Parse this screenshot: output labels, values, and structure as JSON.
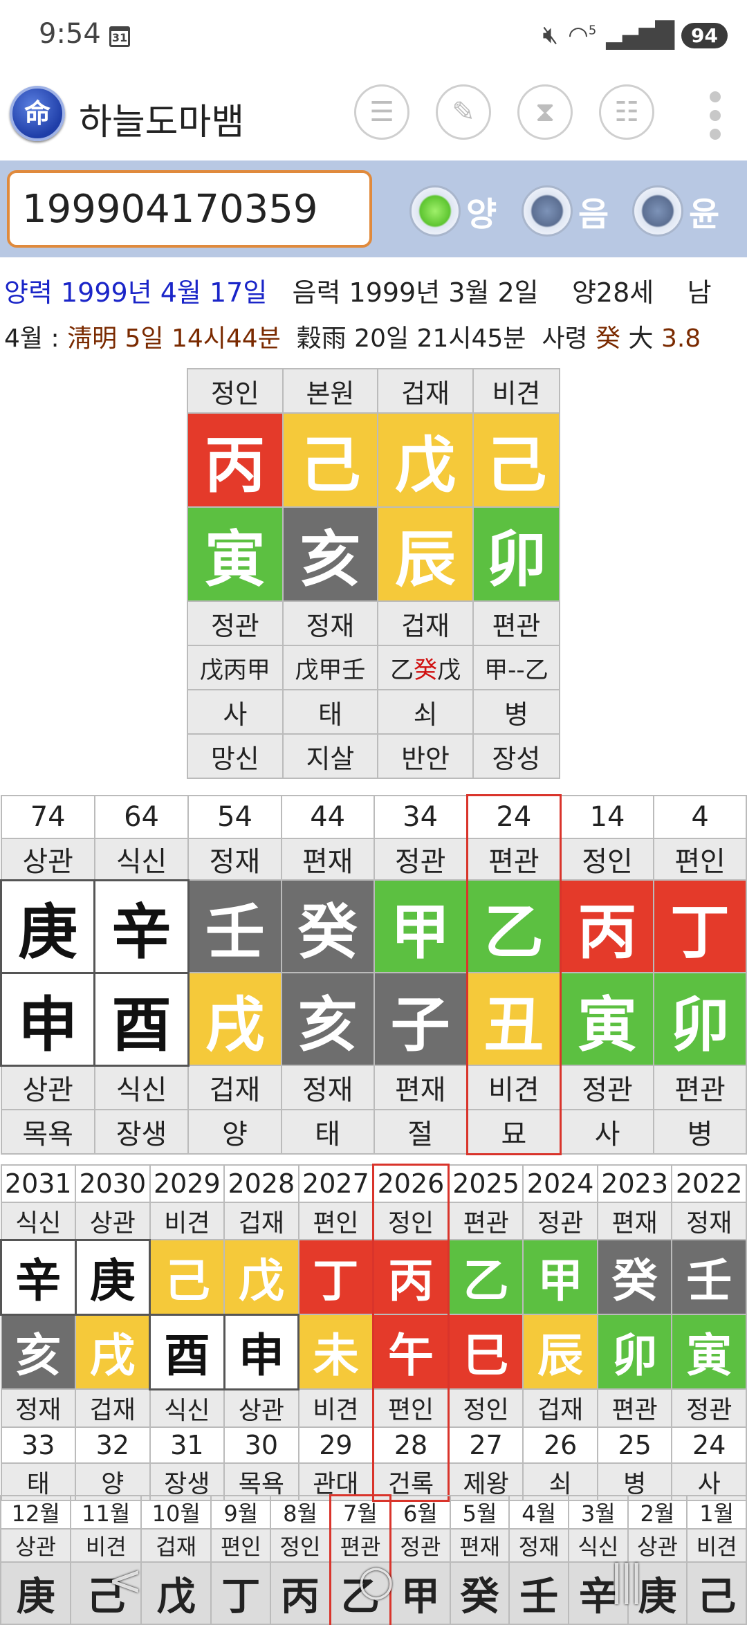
{
  "status": {
    "time": "9:54",
    "calendar_day": "31",
    "wifi_label": "5",
    "battery": "94"
  },
  "app": {
    "logo_char": "命",
    "title": "하늘도마뱀"
  },
  "input": {
    "value": "199904170359"
  },
  "radios": [
    {
      "label": "양",
      "selected": true
    },
    {
      "label": "음",
      "selected": false
    },
    {
      "label": "윤",
      "selected": false
    }
  ],
  "info": {
    "solar": "양력 1999년 4월 17일",
    "lunar": "음력 1999년 3월 2일",
    "age": "양28세",
    "sex": "남",
    "month_prefix": "4월 :",
    "term1": "淸明 5일 14시44분",
    "term2": "穀雨 20일 21시45분",
    "saryeong_label": "사령",
    "saryeong_char": "癸",
    "daeun_char": "大",
    "daeun_num": "3.8"
  },
  "pillars": {
    "top": [
      "정인",
      "본원",
      "겁재",
      "비견"
    ],
    "stems": [
      {
        "c": "丙",
        "k": "R"
      },
      {
        "c": "己",
        "k": "Y"
      },
      {
        "c": "戊",
        "k": "Y"
      },
      {
        "c": "己",
        "k": "Y"
      }
    ],
    "branches": [
      {
        "c": "寅",
        "k": "G"
      },
      {
        "c": "亥",
        "k": "D"
      },
      {
        "c": "辰",
        "k": "Y"
      },
      {
        "c": "卯",
        "k": "G"
      }
    ],
    "gods": [
      "정관",
      "정재",
      "겁재",
      "편관"
    ],
    "hidden": [
      [
        "戊丙甲",
        ""
      ],
      [
        "戊甲壬",
        ""
      ],
      [
        "乙",
        "癸",
        "戊"
      ],
      [
        "甲--乙",
        ""
      ]
    ],
    "stages": [
      "사",
      "태",
      "쇠",
      "병"
    ],
    "spirits": [
      "망신",
      "지살",
      "반안",
      "장성"
    ]
  },
  "daeun": {
    "ages": [
      "74",
      "64",
      "54",
      "44",
      "34",
      "24",
      "14",
      "4"
    ],
    "top": [
      "상관",
      "식신",
      "정재",
      "편재",
      "정관",
      "편관",
      "정인",
      "편인"
    ],
    "stems": [
      {
        "c": "庚",
        "k": "W"
      },
      {
        "c": "辛",
        "k": "W"
      },
      {
        "c": "壬",
        "k": "D"
      },
      {
        "c": "癸",
        "k": "D"
      },
      {
        "c": "甲",
        "k": "G"
      },
      {
        "c": "乙",
        "k": "G"
      },
      {
        "c": "丙",
        "k": "R"
      },
      {
        "c": "丁",
        "k": "R"
      }
    ],
    "branches": [
      {
        "c": "申",
        "k": "W"
      },
      {
        "c": "酉",
        "k": "W"
      },
      {
        "c": "戌",
        "k": "Y"
      },
      {
        "c": "亥",
        "k": "D"
      },
      {
        "c": "子",
        "k": "D"
      },
      {
        "c": "丑",
        "k": "Y"
      },
      {
        "c": "寅",
        "k": "G"
      },
      {
        "c": "卯",
        "k": "G"
      }
    ],
    "bottom": [
      "상관",
      "식신",
      "겁재",
      "정재",
      "편재",
      "비견",
      "정관",
      "편관"
    ],
    "stages": [
      "목욕",
      "장생",
      "양",
      "태",
      "절",
      "묘",
      "사",
      "병"
    ],
    "selected": 5
  },
  "yearly": {
    "years": [
      "2031",
      "2030",
      "2029",
      "2028",
      "2027",
      "2026",
      "2025",
      "2024",
      "2023",
      "2022"
    ],
    "top": [
      "식신",
      "상관",
      "비견",
      "겁재",
      "편인",
      "정인",
      "편관",
      "정관",
      "편재",
      "정재"
    ],
    "stems": [
      {
        "c": "辛",
        "k": "W"
      },
      {
        "c": "庚",
        "k": "W"
      },
      {
        "c": "己",
        "k": "Y"
      },
      {
        "c": "戊",
        "k": "Y"
      },
      {
        "c": "丁",
        "k": "R"
      },
      {
        "c": "丙",
        "k": "R"
      },
      {
        "c": "乙",
        "k": "G"
      },
      {
        "c": "甲",
        "k": "G"
      },
      {
        "c": "癸",
        "k": "D"
      },
      {
        "c": "壬",
        "k": "D"
      }
    ],
    "branches": [
      {
        "c": "亥",
        "k": "D"
      },
      {
        "c": "戌",
        "k": "Y"
      },
      {
        "c": "酉",
        "k": "W"
      },
      {
        "c": "申",
        "k": "W"
      },
      {
        "c": "未",
        "k": "Y"
      },
      {
        "c": "午",
        "k": "R"
      },
      {
        "c": "巳",
        "k": "R"
      },
      {
        "c": "辰",
        "k": "Y"
      },
      {
        "c": "卯",
        "k": "G"
      },
      {
        "c": "寅",
        "k": "G"
      }
    ],
    "bottom": [
      "정재",
      "겁재",
      "식신",
      "상관",
      "비견",
      "편인",
      "정인",
      "겁재",
      "편관",
      "정관"
    ],
    "ages": [
      "33",
      "32",
      "31",
      "30",
      "29",
      "28",
      "27",
      "26",
      "25",
      "24"
    ],
    "stages": [
      "태",
      "양",
      "장생",
      "목욕",
      "관대",
      "건록",
      "제왕",
      "쇠",
      "병",
      "사"
    ],
    "selected": 5
  },
  "monthly": {
    "months": [
      "12월",
      "11월",
      "10월",
      "9월",
      "8월",
      "7월",
      "6월",
      "5월",
      "4월",
      "3월",
      "2월",
      "1월"
    ],
    "top": [
      "상관",
      "비견",
      "겁재",
      "편인",
      "정인",
      "편관",
      "정관",
      "편재",
      "정재",
      "식신",
      "상관",
      "비견"
    ],
    "stems": [
      "庚",
      "己",
      "戊",
      "丁",
      "丙",
      "乙",
      "甲",
      "癸",
      "壬",
      "辛",
      "庚",
      "己"
    ],
    "selected": 5
  },
  "navbar": {
    "back": "<",
    "home": "○",
    "recents": "|||"
  },
  "colors": {
    "fire": "#e43a2a",
    "earth": "#f5c93a",
    "wood": "#5cc041",
    "water": "#6e6e6e",
    "metal": "#ffffff",
    "accent": "#1a25c8",
    "highlight": "#d9342b"
  }
}
